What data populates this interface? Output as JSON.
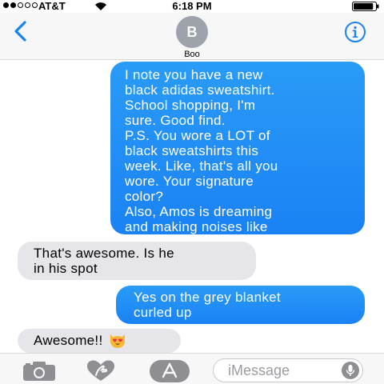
{
  "status_bar": {
    "carrier": "AT&T",
    "time": "6:18 PM",
    "signal_bars_filled": 2,
    "signal_bars_total": 5,
    "battery_level": 0.9
  },
  "header": {
    "avatar_initial": "B",
    "contact_name": "Boo",
    "back_icon": "chevron-left-icon",
    "info_icon": "info-icon",
    "accent_color": "#1a82f4"
  },
  "messages": [
    {
      "direction": "outgoing",
      "text": "I note you have a new\nblack adidas sweatshirt.\nSchool shopping, I'm\nsure. Good find.\nP.S. You wore a LOT of\nblack sweatshirts this\nweek. Like, that's all you\nwore. Your signature\ncolor?\nAlso, Amos is dreaming\nand making noises like\nDakota did. It's cute :)"
    },
    {
      "direction": "incoming",
      "text": "That's awesome. Is he\nin his spot"
    },
    {
      "direction": "outgoing",
      "text": "Yes on the grey blanket\ncurled up"
    },
    {
      "direction": "incoming",
      "text": "Awesome!!",
      "emoji_icon": "heart-eyes-cat-icon"
    }
  ],
  "input_bar": {
    "placeholder": "iMessage",
    "camera_icon": "camera-icon",
    "digital_touch_icon": "digital-touch-heart-icon",
    "app_store_icon": "app-store-icon",
    "dictation_icon": "microphone-icon"
  },
  "colors": {
    "outgoing_bubble": "#1a82f4",
    "incoming_bubble": "#e5e5ea",
    "icon_gray": "#8e8e93"
  }
}
